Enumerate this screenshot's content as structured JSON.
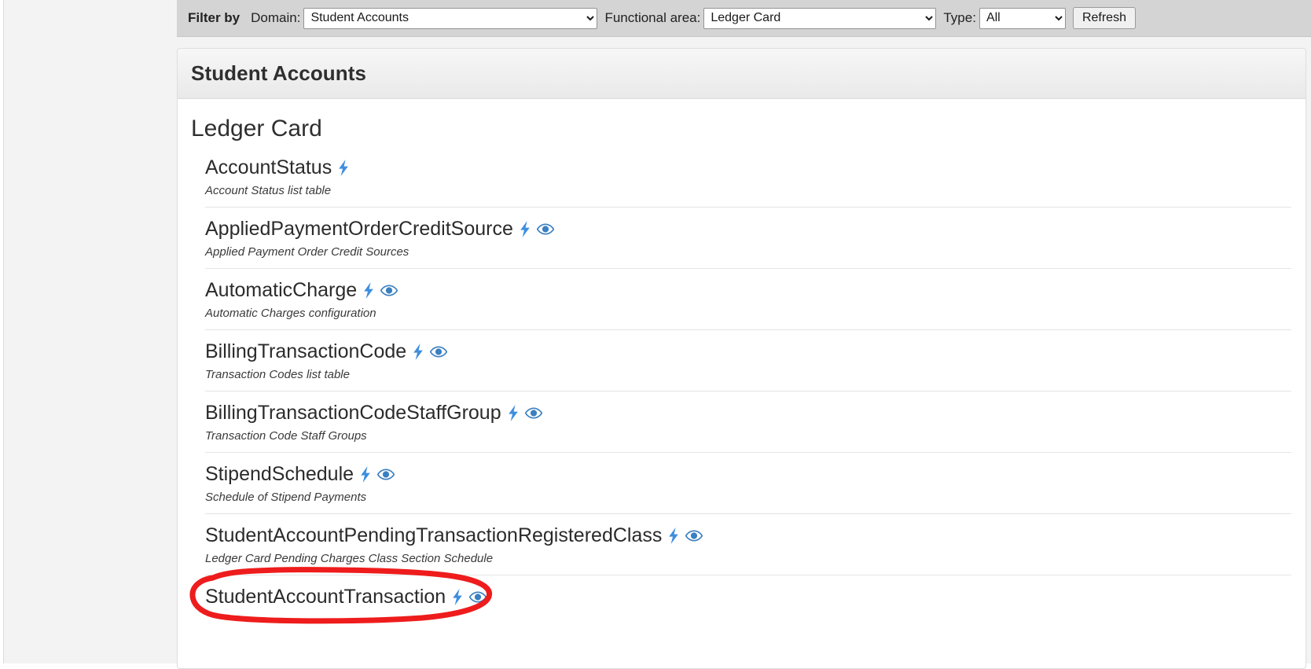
{
  "filter_bar": {
    "filter_by_label": "Filter by",
    "domain_label": "Domain:",
    "domain_value": "Student Accounts",
    "functional_area_label": "Functional area:",
    "functional_area_value": "Ledger Card",
    "type_label": "Type:",
    "type_value": "All",
    "refresh_label": "Refresh"
  },
  "panel": {
    "title": "Student Accounts",
    "section_title": "Ledger Card"
  },
  "icons": {
    "bolt": "lightning-bolt-icon",
    "eye": "eye-icon",
    "bolt_color": "#3e8ede",
    "eye_color": "#3a7fc1"
  },
  "annotation": {
    "color": "#ee1c1c",
    "shape": "hand-drawn-ellipse",
    "target": "StudentAccountTransaction"
  },
  "entities": [
    {
      "name": "AccountStatus",
      "description": "Account Status list table",
      "has_bolt": true,
      "has_eye": false
    },
    {
      "name": "AppliedPaymentOrderCreditSource",
      "description": "Applied Payment Order Credit Sources",
      "has_bolt": true,
      "has_eye": true
    },
    {
      "name": "AutomaticCharge",
      "description": "Automatic Charges configuration",
      "has_bolt": true,
      "has_eye": true
    },
    {
      "name": "BillingTransactionCode",
      "description": "Transaction Codes list table",
      "has_bolt": true,
      "has_eye": true
    },
    {
      "name": "BillingTransactionCodeStaffGroup",
      "description": "Transaction Code Staff Groups",
      "has_bolt": true,
      "has_eye": true
    },
    {
      "name": "StipendSchedule",
      "description": "Schedule of Stipend Payments",
      "has_bolt": true,
      "has_eye": true
    },
    {
      "name": "StudentAccountPendingTransactionRegisteredClass",
      "description": "Ledger Card Pending Charges Class Section Schedule",
      "has_bolt": true,
      "has_eye": true
    },
    {
      "name": "StudentAccountTransaction",
      "description": "",
      "has_bolt": true,
      "has_eye": true
    }
  ]
}
